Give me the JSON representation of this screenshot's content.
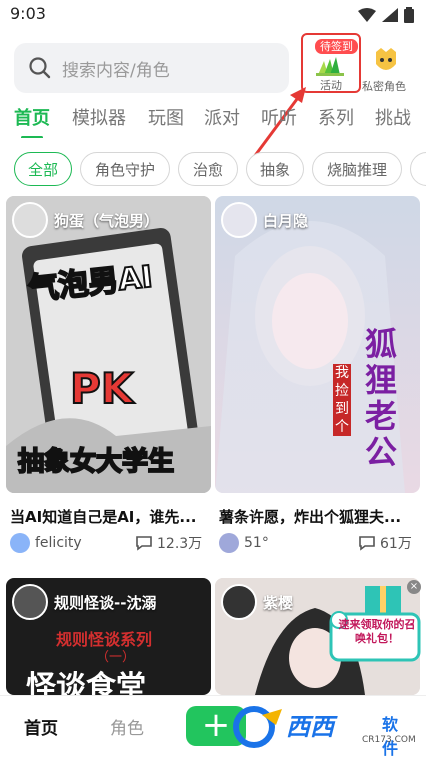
{
  "status_bar": {
    "time": "9:03"
  },
  "search": {
    "placeholder": "搜索内容/角色"
  },
  "activity": {
    "badge": "待签到",
    "label": "活动"
  },
  "secret_role": {
    "label": "私密角色"
  },
  "tabs": [
    {
      "label": "首页",
      "active": true
    },
    {
      "label": "模拟器"
    },
    {
      "label": "玩图"
    },
    {
      "label": "派对"
    },
    {
      "label": "听听"
    },
    {
      "label": "系列"
    },
    {
      "label": "挑战"
    }
  ],
  "chips": [
    {
      "label": "全部",
      "active": true
    },
    {
      "label": "角色守护"
    },
    {
      "label": "治愈"
    },
    {
      "label": "抽象"
    },
    {
      "label": "烧脑推理"
    }
  ],
  "cards": [
    {
      "character": "狗蛋（气泡男）",
      "cover_text_top": "气泡男AI",
      "cover_text_mid": "PK",
      "cover_text_bottom": "抽象女大学生",
      "title": "当AI知道自己是AI，谁先...",
      "author": "felicity",
      "count": "12.3万"
    },
    {
      "character": "白月隐",
      "cover_text_side": "狐狸老公",
      "cover_text_small": "我捡到个",
      "title": "薯条许愿，炸出个狐狸夫...",
      "author": "51°",
      "count": "61万"
    },
    {
      "character": "规则怪谈--沈溺",
      "cover_text_top": "规则怪谈系列",
      "cover_text_mid": "（一）",
      "cover_text_bottom": "怪谈食堂"
    },
    {
      "character": "紫樱"
    }
  ],
  "gift": {
    "text": "速来领取你的召唤礼包！",
    "close": "×"
  },
  "bottom_nav": {
    "home": "首页",
    "role": "角色",
    "plus": "+"
  },
  "watermark": {
    "name": "西西",
    "sub": "软件园",
    "url": "CR173.COM"
  },
  "colors": {
    "accent": "#1db954",
    "badge": "#ff4d4f",
    "highlight_border": "#e53935"
  }
}
